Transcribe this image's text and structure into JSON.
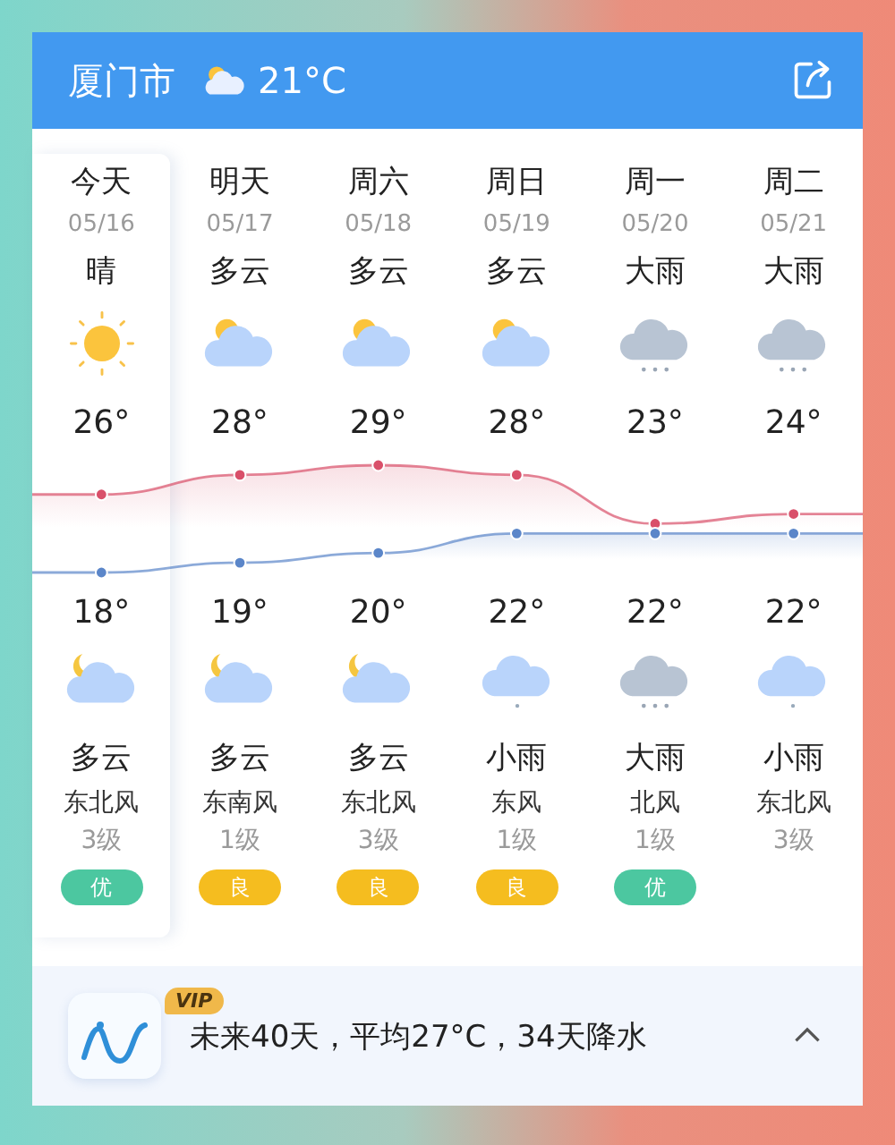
{
  "header": {
    "city": "厦门市",
    "current_icon": {
      "kind": "cloudy_day"
    },
    "current_temp": "21°C"
  },
  "days": [
    {
      "label": "今天",
      "date": "05/16",
      "day_condition": "晴",
      "day_icon": {
        "kind": "sunny"
      },
      "high": "26°",
      "low": "18°",
      "night_icon": {
        "kind": "cloudy_night"
      },
      "night_condition": "多云",
      "wind": "东北风",
      "wind_level": "3级",
      "aqi": {
        "text": "优",
        "color": "#4cc7a0"
      },
      "selected": true
    },
    {
      "label": "明天",
      "date": "05/17",
      "day_condition": "多云",
      "day_icon": {
        "kind": "cloudy_day"
      },
      "high": "28°",
      "low": "19°",
      "night_icon": {
        "kind": "cloudy_night"
      },
      "night_condition": "多云",
      "wind": "东南风",
      "wind_level": "1级",
      "aqi": {
        "text": "良",
        "color": "#f5bd1f"
      },
      "selected": false
    },
    {
      "label": "周六",
      "date": "05/18",
      "day_condition": "多云",
      "day_icon": {
        "kind": "cloudy_day"
      },
      "high": "29°",
      "low": "20°",
      "night_icon": {
        "kind": "cloudy_night"
      },
      "night_condition": "多云",
      "wind": "东北风",
      "wind_level": "3级",
      "aqi": {
        "text": "良",
        "color": "#f5bd1f"
      },
      "selected": false
    },
    {
      "label": "周日",
      "date": "05/19",
      "day_condition": "多云",
      "day_icon": {
        "kind": "cloudy_day"
      },
      "high": "28°",
      "low": "22°",
      "night_icon": {
        "kind": "light_rain"
      },
      "night_condition": "小雨",
      "wind": "东风",
      "wind_level": "1级",
      "aqi": {
        "text": "良",
        "color": "#f5bd1f"
      },
      "selected": false
    },
    {
      "label": "周一",
      "date": "05/20",
      "day_condition": "大雨",
      "day_icon": {
        "kind": "heavy_rain"
      },
      "high": "23°",
      "low": "22°",
      "night_icon": {
        "kind": "heavy_rain"
      },
      "night_condition": "大雨",
      "wind": "北风",
      "wind_level": "1级",
      "aqi": {
        "text": "优",
        "color": "#4cc7a0"
      },
      "selected": false
    },
    {
      "label": "周二",
      "date": "05/21",
      "day_condition": "大雨",
      "day_icon": {
        "kind": "heavy_rain"
      },
      "high": "24°",
      "low": "22°",
      "night_icon": {
        "kind": "light_rain"
      },
      "night_condition": "小雨",
      "wind": "东北风",
      "wind_level": "3级",
      "selected": false
    }
  ],
  "outlook": {
    "badge": "VIP",
    "text": "未来40天，平均27°C，34天降水",
    "expanded": true
  }
}
